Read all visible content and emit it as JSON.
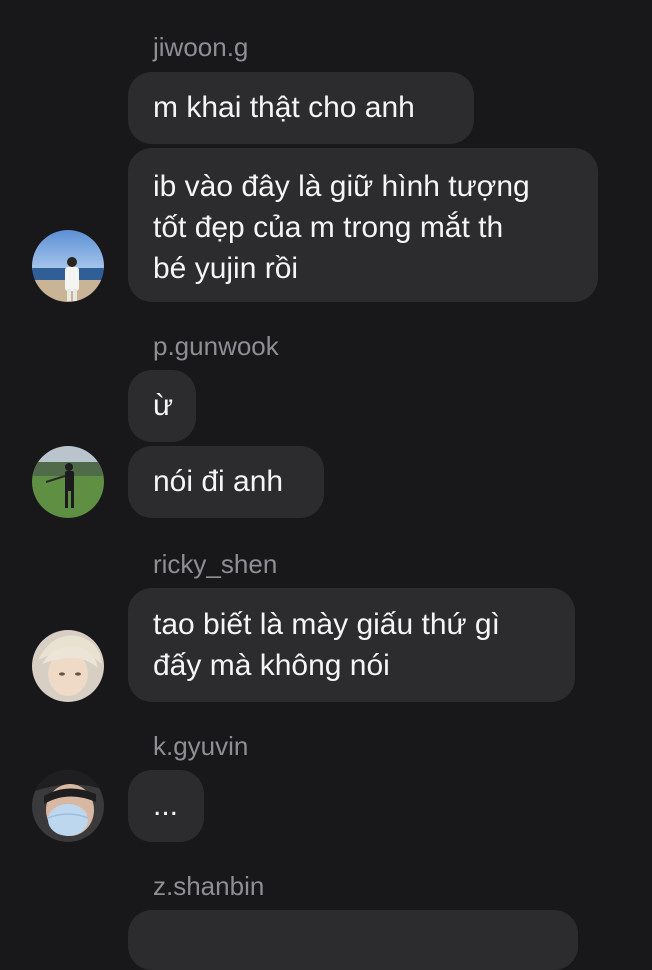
{
  "messages": [
    {
      "sender": "jiwoon.g",
      "bubbles": [
        "m khai thật cho anh",
        "ib vào đây là giữ hình tượng",
        "tốt đẹp của m trong mắt th",
        "bé yujin rồi"
      ]
    },
    {
      "sender": "p.gunwook",
      "bubbles": [
        "ừ",
        "nói đi anh"
      ]
    },
    {
      "sender": "ricky_shen",
      "bubbles": [
        "tao biết là mày giấu thứ gì",
        "đấy mà không nói"
      ]
    },
    {
      "sender": "k.gyuvin",
      "bubbles": [
        "..."
      ]
    },
    {
      "sender": "z.shanbin",
      "bubbles": []
    }
  ],
  "colors": {
    "background": "#18181a",
    "bubble": "#2c2c2e",
    "sender_text": "#8e8e93",
    "message_text": "#f5f5f7"
  }
}
